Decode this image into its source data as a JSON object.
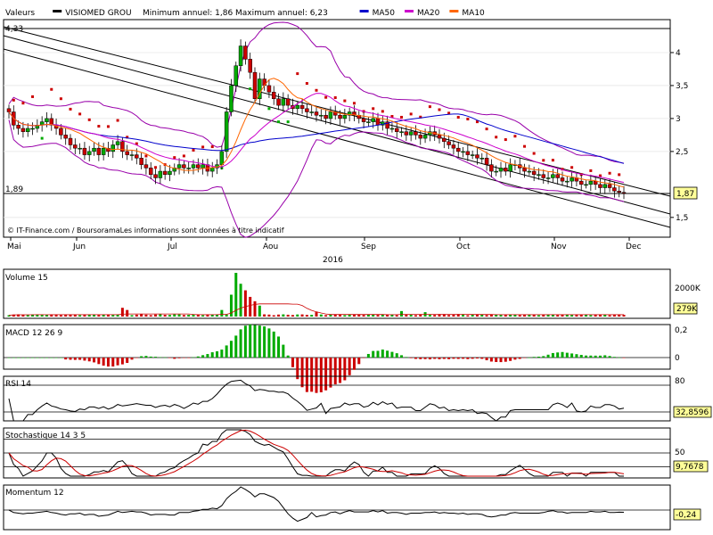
{
  "header": {
    "items": [
      {
        "label": "Valeurs",
        "swatch": ""
      },
      {
        "label": "VISIOMED GROU",
        "swatch": "#000000"
      },
      {
        "label": "Minimum annuel: 1,86 Maximum annuel: 6,23",
        "swatch": ""
      },
      {
        "label": "MA50",
        "swatch": "#0000cc"
      },
      {
        "label": "MA20",
        "swatch": "#cc00cc"
      },
      {
        "label": "MA10",
        "swatch": "#ff6600"
      }
    ]
  },
  "credit": "© IT-Finance.com / BoursoramaLes informations sont données à titre indicatif",
  "colors": {
    "up": "#00aa00",
    "down": "#cc0000",
    "ma50": "#0000cc",
    "ma20": "#cc00cc",
    "ma10": "#ff6600",
    "sar": "#cc0000",
    "sar_low": "#00aa00",
    "badge": "#ffff99"
  },
  "chart_data": [
    {
      "type": "candlestick",
      "name": "price",
      "year_label": "2016",
      "months": [
        "Mai",
        "Jun",
        "Jul",
        "Aou",
        "Sep",
        "Oct",
        "Nov",
        "Dec"
      ],
      "yticks": [
        "4",
        "3,5",
        "3",
        "2,5",
        "1,5"
      ],
      "ylim": [
        1.2,
        4.5
      ],
      "left_values": [
        "4,33",
        "1,89"
      ],
      "last_label": "1,87",
      "closes": [
        3.1,
        2.9,
        2.85,
        2.8,
        2.85,
        2.85,
        2.9,
        2.95,
        3.0,
        2.9,
        2.85,
        2.75,
        2.7,
        2.6,
        2.55,
        2.55,
        2.45,
        2.5,
        2.55,
        2.45,
        2.55,
        2.5,
        2.6,
        2.65,
        2.5,
        2.45,
        2.45,
        2.4,
        2.3,
        2.25,
        2.15,
        2.1,
        2.2,
        2.15,
        2.2,
        2.25,
        2.3,
        2.25,
        2.25,
        2.3,
        2.25,
        2.3,
        2.2,
        2.25,
        2.3,
        2.5,
        3.1,
        3.5,
        3.8,
        4.1,
        3.9,
        3.7,
        3.3,
        3.6,
        3.5,
        3.4,
        3.3,
        3.2,
        3.3,
        3.2,
        3.15,
        3.2,
        3.15,
        3.1,
        3.1,
        3.05,
        3.05,
        3.0,
        3.1,
        3.05,
        3.0,
        3.05,
        3.1,
        3.05,
        3.0,
        2.95,
        2.95,
        3.0,
        2.9,
        2.95,
        2.85,
        2.85,
        2.8,
        2.8,
        2.75,
        2.8,
        2.75,
        2.7,
        2.75,
        2.8,
        2.75,
        2.7,
        2.65,
        2.6,
        2.55,
        2.5,
        2.5,
        2.45,
        2.45,
        2.4,
        2.4,
        2.3,
        2.2,
        2.2,
        2.25,
        2.2,
        2.3,
        2.3,
        2.25,
        2.2,
        2.2,
        2.15,
        2.15,
        2.1,
        2.1,
        2.15,
        2.1,
        2.05,
        2.05,
        2.1,
        2.05,
        2.0,
        2.0,
        2.05,
        2.0,
        1.95,
        2.0,
        1.95,
        1.9,
        1.88,
        1.87
      ]
    },
    {
      "type": "bar",
      "name": "Volume 15",
      "title": "Volume 15",
      "yticks": [
        "2000K"
      ],
      "last_label": "279K",
      "spikes": {
        "47": 1000,
        "48": 2000,
        "49": 1500,
        "50": 1200,
        "51": 900,
        "52": 700,
        "53": 500,
        "24": 400,
        "25": 300,
        "45": 300,
        "65": 200,
        "83": 250,
        "88": 200
      }
    },
    {
      "type": "bar",
      "name": "MACD 12 26 9",
      "title": "MACD 12 26 9",
      "yticks": [
        "0,2",
        "0"
      ]
    },
    {
      "type": "line",
      "name": "RSI 14",
      "title": "RSI 14",
      "yticks": [
        "80"
      ],
      "last_label": "32,8596"
    },
    {
      "type": "line",
      "name": "Stochastique 14 3 5",
      "title": "Stochastique 14 3 5",
      "yticks": [
        "50"
      ],
      "last_label": "9,7678"
    },
    {
      "type": "line",
      "name": "Momentum 12",
      "title": "Momentum 12",
      "yticks": [],
      "last_label": "-0,24"
    }
  ]
}
